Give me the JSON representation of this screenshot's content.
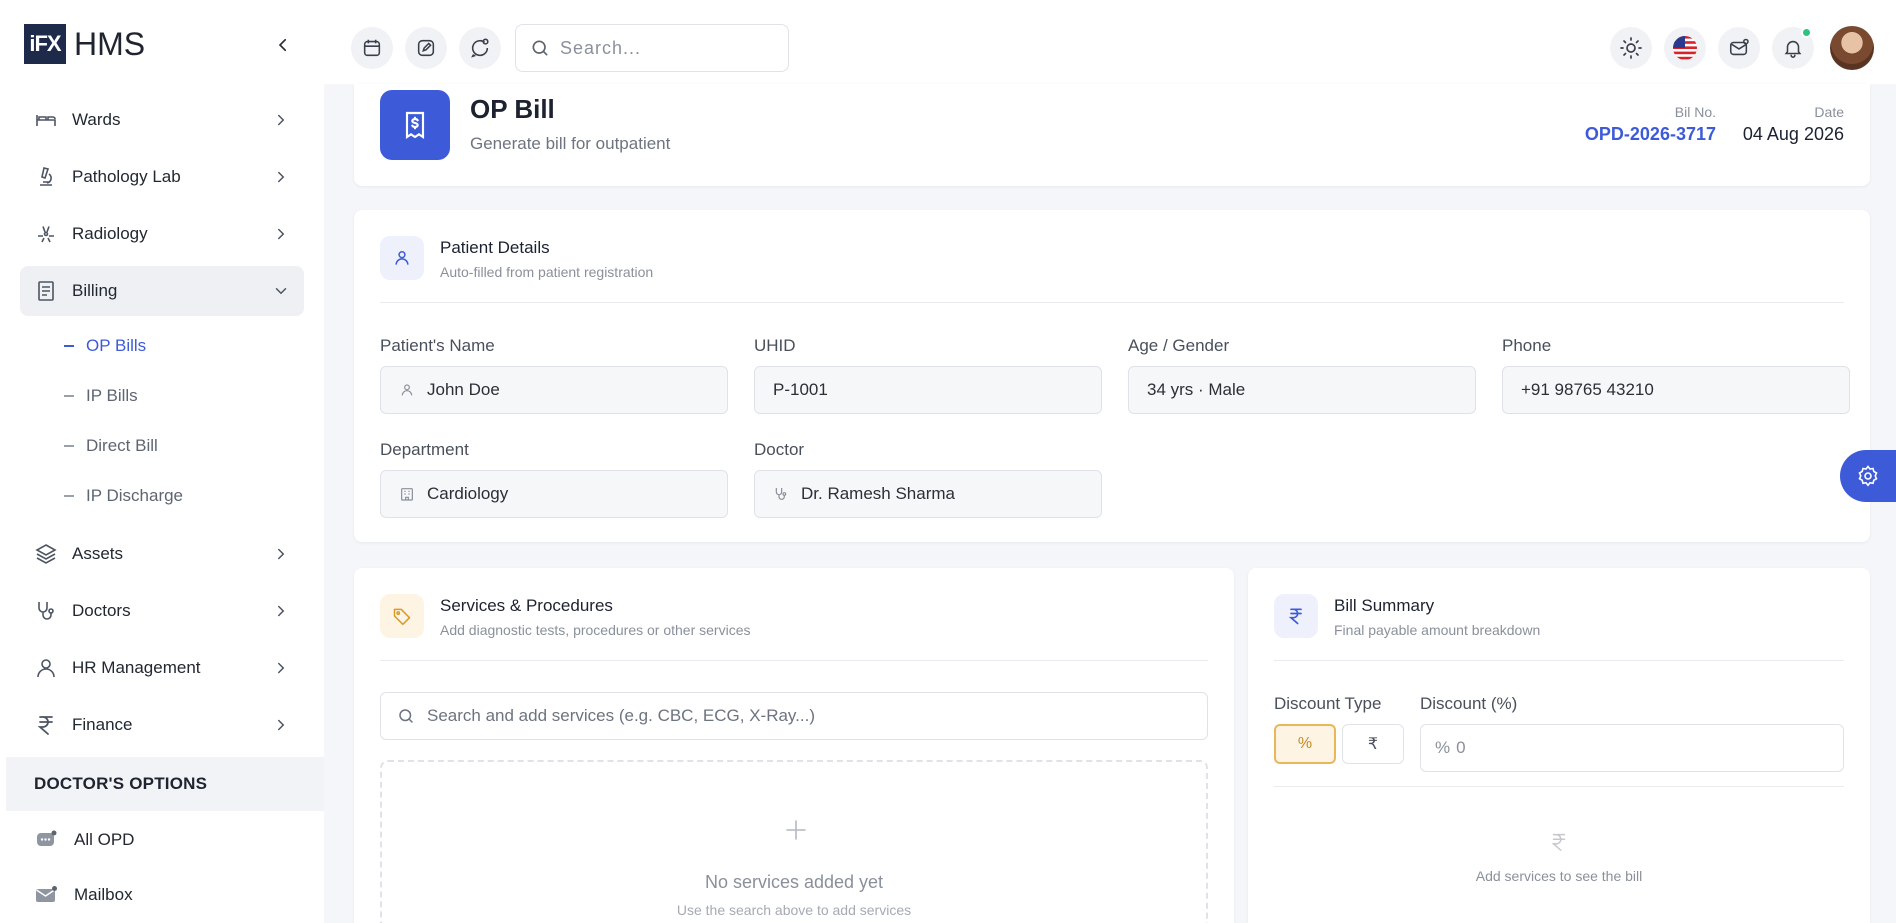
{
  "brand": {
    "logo_text": "iFX",
    "name": "HMS"
  },
  "sidebar": {
    "items": [
      {
        "label": "Wards",
        "icon": "bed-icon"
      },
      {
        "label": "Pathology Lab",
        "icon": "microscope-icon"
      },
      {
        "label": "Radiology",
        "icon": "radiation-icon"
      },
      {
        "label": "Billing",
        "icon": "receipt-icon",
        "expanded": true
      }
    ],
    "billing_sub": [
      {
        "label": "OP Bills",
        "active": true
      },
      {
        "label": "IP Bills"
      },
      {
        "label": "Direct Bill"
      },
      {
        "label": "IP Discharge"
      }
    ],
    "items_after": [
      {
        "label": "Assets",
        "icon": "layers-icon"
      },
      {
        "label": "Doctors",
        "icon": "stethoscope-icon"
      },
      {
        "label": "HR Management",
        "icon": "user-icon"
      },
      {
        "label": "Finance",
        "icon": "rupee-icon"
      }
    ],
    "section_title": "DOCTOR'S OPTIONS",
    "options": [
      {
        "label": "All OPD",
        "icon": "chat-icon"
      },
      {
        "label": "Mailbox",
        "icon": "mail-icon"
      }
    ]
  },
  "topbar": {
    "search_placeholder": "Search...",
    "icons": [
      "calendar-icon",
      "edit-icon",
      "chat-icon",
      "sun-icon",
      "us-flag-icon",
      "mail-icon",
      "bell-icon"
    ]
  },
  "header": {
    "title": "OP Bill",
    "subtitle": "Generate bill for outpatient",
    "bill_no_label": "Bil No.",
    "bill_no": "OPD-2026-3717",
    "date_label": "Date",
    "date": "04 Aug 2026"
  },
  "patient": {
    "title": "Patient Details",
    "subtitle": "Auto-filled from patient registration",
    "fields": {
      "name": {
        "label": "Patient's Name",
        "value": "John Doe"
      },
      "uhid": {
        "label": "UHID",
        "value": "P-1001"
      },
      "age_gender": {
        "label": "Age / Gender",
        "value": "34 yrs · Male"
      },
      "phone": {
        "label": "Phone",
        "value": "+91 98765 43210"
      },
      "department": {
        "label": "Department",
        "value": "Cardiology"
      },
      "doctor": {
        "label": "Doctor",
        "value": "Dr. Ramesh Sharma"
      }
    }
  },
  "services": {
    "title": "Services & Procedures",
    "subtitle": "Add diagnostic tests, procedures or other services",
    "search_placeholder": "Search and add services (e.g. CBC, ECG, X-Ray...)",
    "empty_title": "No services added yet",
    "empty_sub": "Use the search above to add services"
  },
  "summary": {
    "title": "Bill Summary",
    "subtitle": "Final payable amount breakdown",
    "discount_type_label": "Discount Type",
    "discount_label": "Discount (%)",
    "pct_symbol": "%",
    "inr_symbol": "₹",
    "discount_prefix": "%",
    "discount_value": "0",
    "empty_text": "Add services to see the bill"
  },
  "colors": {
    "accent": "#3d5bd9",
    "warn": "#e8b75a"
  }
}
